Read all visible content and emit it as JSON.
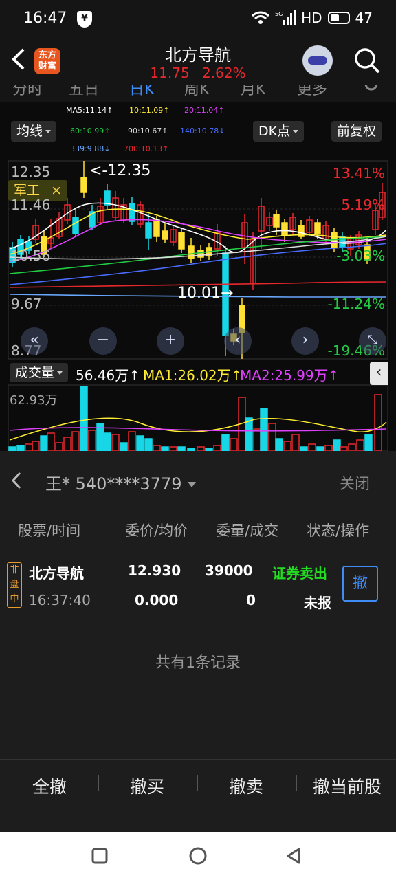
{
  "status_bar": {
    "time": "16:47",
    "shield_glyph": "¥",
    "net": "5G",
    "hd": "HD",
    "battery": "47"
  },
  "header": {
    "title": "北方导航",
    "price": "11.75",
    "change_pct": "2.62%",
    "logo_line1": "东方",
    "logo_line2": "财富"
  },
  "tabs": [
    "分时",
    "五日",
    "日K",
    "周K",
    "月K",
    "更多"
  ],
  "chart": {
    "ma_legend": [
      {
        "label": "MA5:11.14↑",
        "color": "#ffffff"
      },
      {
        "label": "10:11.09↑",
        "color": "#ffee33"
      },
      {
        "label": "20:11.04↑",
        "color": "#e040ff"
      },
      {
        "label": "60:10.99↑",
        "color": "#22cc44"
      },
      {
        "label": "90:10.67↑",
        "color": "#dddddd"
      },
      {
        "label": "140:10.78↓",
        "color": "#4a6cff"
      },
      {
        "label": "339:9.88↓",
        "color": "#6aa8ff"
      },
      {
        "label": "700:10.13↑",
        "color": "#e8282d"
      }
    ],
    "indicator_button": "均线",
    "dk_button": "DK点",
    "adjust_button": "前复权",
    "tag_label": "军工",
    "tag_close": "×",
    "high_marker": "<-12.35",
    "low_marker": "10.01→",
    "y_left": [
      "12.35",
      "11.46",
      "10.56",
      "9.67",
      "8.77"
    ],
    "y_right": [
      "13.41%",
      "5.19%",
      "-3.03%",
      "-11.24%",
      "-19.46%"
    ],
    "volume_button": "成交量",
    "volume_value": "56.46万↑",
    "volume_ma1": "MA1:26.02万↑",
    "volume_ma2": "MA2:25.99万↑",
    "volume_axis": "62.93万",
    "up_color": "#e8282d",
    "down_color": "#17d6e6"
  },
  "sheet": {
    "account": "王* 540****3779",
    "close": "关闭",
    "columns": [
      "股票/时间",
      "委价/均价",
      "委量/成交",
      "状态/操作"
    ],
    "order": {
      "name": "北方导航",
      "time": "16:37:40",
      "price": "12.930",
      "avg_price": "0.000",
      "quantity": "39000",
      "filled": "0",
      "side": "证券卖出",
      "status": "未报",
      "badge": "非盘中",
      "cancel": "撤"
    },
    "records": "共有1条记录",
    "actions": [
      "全撤",
      "撤买",
      "撤卖",
      "撤当前股"
    ]
  }
}
